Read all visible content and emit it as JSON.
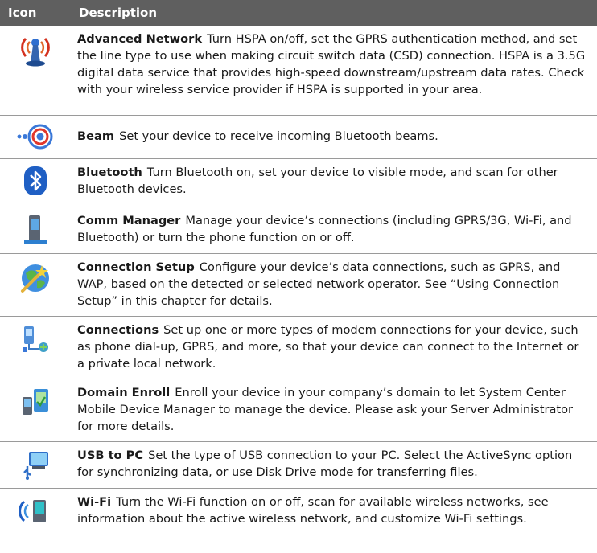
{
  "header": {
    "col_icon": "Icon",
    "col_description": "Description"
  },
  "rows": [
    {
      "icon": "advanced-network-icon",
      "title": "Advanced Network",
      "text": "Turn HSPA on/off, set the GPRS authentication method, and set the line type to use when making circuit switch data (CSD) connection. HSPA is a 3.5G digital data service that provides high-speed downstream/upstream data rates. Check with your wireless service provider if HSPA is supported in your area."
    },
    {
      "icon": "beam-icon",
      "title": "Beam",
      "text": "Set your device to receive incoming Bluetooth beams."
    },
    {
      "icon": "bluetooth-icon",
      "title": "Bluetooth",
      "text": "Turn Bluetooth on, set your device to visible mode, and scan for other Bluetooth devices."
    },
    {
      "icon": "comm-manager-icon",
      "title": "Comm Manager",
      "text": "Manage your device’s connections (including GPRS/3G, Wi-Fi, and Bluetooth) or turn the phone function on or off."
    },
    {
      "icon": "connection-setup-icon",
      "title": "Connection Setup",
      "text": "Configure your device’s data connections, such as GPRS, and WAP, based on the detected or selected network operator. See “Using Connection Setup” in this chapter for details."
    },
    {
      "icon": "connections-icon",
      "title": "Connections",
      "text": "Set up one or more types of modem connections for your device, such as phone dial-up, GPRS, and more, so that your device can connect to the Internet or a private local network."
    },
    {
      "icon": "domain-enroll-icon",
      "title": "Domain Enroll",
      "text": "Enroll your device in your company’s domain to let System Center Mobile Device Manager to manage the device. Please ask your Server Administrator for more details."
    },
    {
      "icon": "usb-to-pc-icon",
      "title": "USB to PC",
      "text": "Set the type of USB connection to your PC. Select the ActiveSync option for synchronizing data, or use Disk Drive mode for transferring files."
    },
    {
      "icon": "wifi-icon",
      "title": "Wi-Fi",
      "text": "Turn the Wi-Fi function on or off, scan for available wireless networks, see information about the active wireless network, and customize Wi-Fi settings."
    }
  ]
}
